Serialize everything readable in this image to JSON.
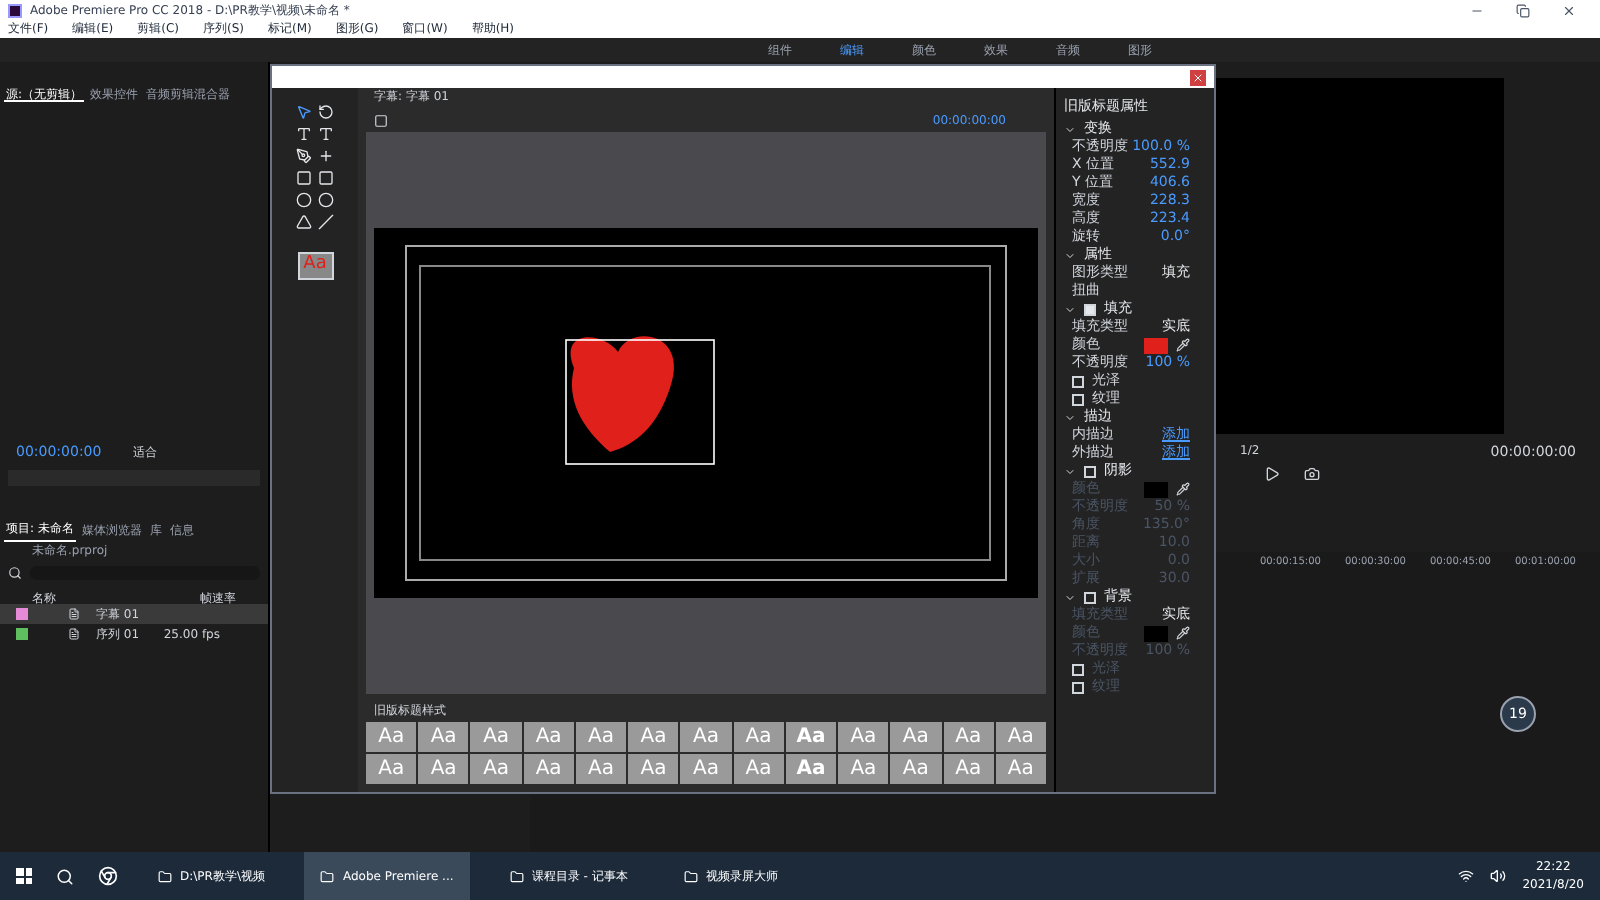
{
  "window": {
    "title": "Adobe Premiere Pro CC 2018 - D:\\PR教学\\视频\\未命名 *"
  },
  "menu": [
    "文件(F)",
    "编辑(E)",
    "剪辑(C)",
    "序列(S)",
    "标记(M)",
    "图形(G)",
    "窗口(W)",
    "帮助(H)"
  ],
  "workspaces": [
    {
      "label": "组件",
      "selected": false
    },
    {
      "label": "编辑",
      "selected": true
    },
    {
      "label": "颜色",
      "selected": false
    },
    {
      "label": "效果",
      "selected": false
    },
    {
      "label": "音频",
      "selected": false
    },
    {
      "label": "图形",
      "selected": false
    }
  ],
  "source_panel": {
    "tabs": [
      {
        "label": "源:（无剪辑）",
        "selected": true
      },
      {
        "label": "效果控件",
        "selected": false
      },
      {
        "label": "音频剪辑混合器",
        "selected": false
      }
    ],
    "timecode": "00:00:00:00",
    "zoom": "适合"
  },
  "project_panel": {
    "tabs": [
      {
        "label": "项目: 未命名",
        "selected": true
      },
      {
        "label": "媒体浏览器",
        "selected": false
      },
      {
        "label": "库",
        "selected": false
      },
      {
        "label": "信息",
        "selected": false
      }
    ],
    "file": "未命名.prproj",
    "columns": [
      "名称",
      "帧速率"
    ],
    "items": [
      {
        "name": "字幕 01",
        "color": "#e58ad6",
        "selected": true
      },
      {
        "name": "序列 01",
        "rate": "25.00 fps",
        "color": "#5fbf5f",
        "selected": false
      }
    ]
  },
  "title_editor": {
    "tab": "字幕: 字幕 01",
    "timecode": "00:00:00:00",
    "styles_tab": "旧版标题样式",
    "swatch": "Aa",
    "styles": [
      "Aa",
      "Aa",
      "Aa",
      "Aa",
      "Aa",
      "Aa",
      "Aa",
      "Aa",
      "Aa",
      "Aa",
      "Aa",
      "Aa",
      "Aa",
      "Aa",
      "Aa",
      "Aa",
      "Aa",
      "Aa",
      "Aa",
      "Aa",
      "Aa",
      "Aa",
      "Aa",
      "Aa",
      "Aa",
      "Aa"
    ]
  },
  "properties": {
    "tab": "旧版标题属性",
    "sections": [
      {
        "label": "变换",
        "expanded": true,
        "rows": [
          {
            "kind": "value",
            "label": "不透明度",
            "value": "100.0 %"
          },
          {
            "kind": "value",
            "label": "X 位置",
            "value": "552.9"
          },
          {
            "kind": "value",
            "label": "Y 位置",
            "value": "406.6"
          },
          {
            "kind": "value",
            "label": "宽度",
            "value": "228.3"
          },
          {
            "kind": "value",
            "label": "高度",
            "value": "223.4"
          },
          {
            "kind": "value",
            "label": "旋转",
            "value": "0.0°"
          }
        ]
      },
      {
        "label": "属性",
        "expanded": true,
        "rows": [
          {
            "kind": "select",
            "label": "图形类型",
            "value": "填充"
          },
          {
            "kind": "sub",
            "label": "扭曲"
          }
        ]
      },
      {
        "label": "填充",
        "expanded": true,
        "checked": true,
        "rows": [
          {
            "kind": "select",
            "label": "填充类型",
            "value": "实底"
          },
          {
            "kind": "color",
            "label": "颜色",
            "color": "#e0201a"
          },
          {
            "kind": "value",
            "label": "不透明度",
            "value": "100 %"
          },
          {
            "kind": "check",
            "label": "光泽",
            "checked": false
          },
          {
            "kind": "check",
            "label": "纹理",
            "checked": false
          }
        ]
      },
      {
        "label": "描边",
        "expanded": true,
        "rows": [
          {
            "kind": "link",
            "label": "内描边",
            "value": "添加"
          },
          {
            "kind": "link",
            "label": "外描边",
            "value": "添加"
          }
        ]
      },
      {
        "label": "阴影",
        "expanded": true,
        "checked": false,
        "rows": [
          {
            "kind": "color",
            "label": "颜色",
            "color": "#000000"
          },
          {
            "kind": "value",
            "label": "不透明度",
            "value": "50 %"
          },
          {
            "kind": "value",
            "label": "角度",
            "value": "135.0°"
          },
          {
            "kind": "value",
            "label": "距离",
            "value": "10.0"
          },
          {
            "kind": "value",
            "label": "大小",
            "value": "0.0"
          },
          {
            "kind": "value",
            "label": "扩展",
            "value": "30.0"
          }
        ]
      },
      {
        "label": "背景",
        "expanded": true,
        "checked": false,
        "rows": [
          {
            "kind": "select",
            "label": "填充类型",
            "value": "实底"
          },
          {
            "kind": "color",
            "label": "颜色",
            "color": "#000000"
          },
          {
            "kind": "value",
            "label": "不透明度",
            "value": "100 %"
          },
          {
            "kind": "check",
            "label": "光泽",
            "checked": false
          },
          {
            "kind": "check",
            "label": "纹理",
            "checked": false
          }
        ]
      }
    ]
  },
  "program_panel": {
    "scale": "1/2",
    "timecode": "00:00:00:00"
  },
  "timeline": {
    "ticks": [
      "00:00:15:00",
      "00:00:30:00",
      "00:00:45:00",
      "00:01:00:00"
    ],
    "volume": "19"
  },
  "taskbar": {
    "items": [
      {
        "label": "D:\\PR教学\\视频",
        "selected": false
      },
      {
        "label": "Adobe Premiere ...",
        "selected": true
      },
      {
        "label": "课程目录 - 记事本",
        "selected": false
      },
      {
        "label": "视频录屏大师",
        "selected": false
      }
    ],
    "time": "22:22",
    "date": "2021/8/20"
  }
}
